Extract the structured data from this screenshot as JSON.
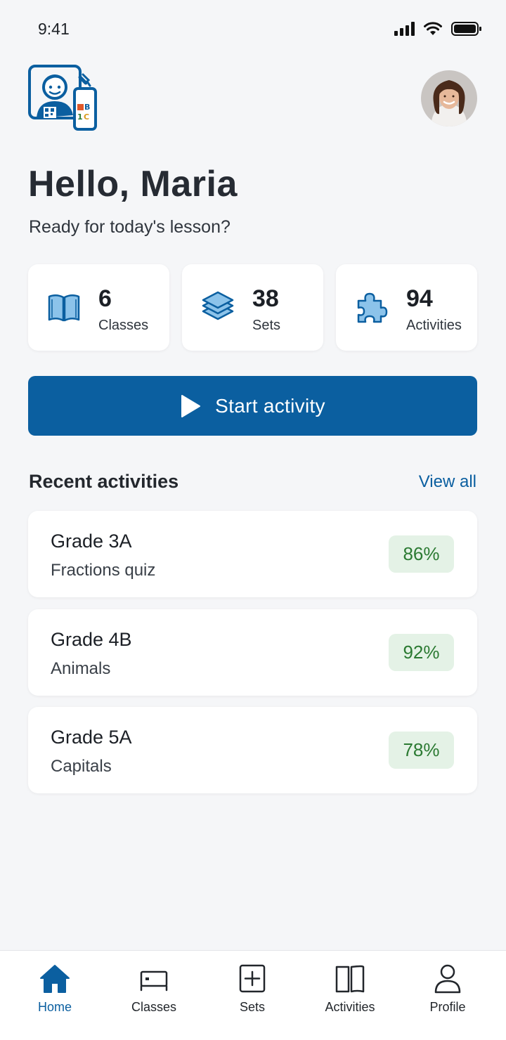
{
  "status_bar": {
    "time": "9:41"
  },
  "header": {
    "greeting": "Hello, Maria",
    "subtitle": "Ready for today's lesson?",
    "logo_icon": "teacher-app-logo",
    "logo_text": "B 1C"
  },
  "stats": [
    {
      "value": "6",
      "label": "Classes",
      "icon": "book-icon"
    },
    {
      "value": "38",
      "label": "Sets",
      "icon": "layers-icon"
    },
    {
      "value": "94",
      "label": "Activities",
      "icon": "puzzle-icon"
    }
  ],
  "start_button": {
    "label": "Start activity"
  },
  "recent": {
    "title": "Recent activities",
    "view_all": "View all",
    "items": [
      {
        "title": "Grade 3A",
        "subtitle": "Fractions quiz",
        "score": "86%"
      },
      {
        "title": "Grade 4B",
        "subtitle": "Animals",
        "score": "92%"
      },
      {
        "title": "Grade 5A",
        "subtitle": "Capitals",
        "score": "78%"
      }
    ]
  },
  "nav": [
    {
      "label": "Home",
      "icon": "home-icon",
      "active": true
    },
    {
      "label": "Classes",
      "icon": "classes-icon"
    },
    {
      "label": "Sets",
      "icon": "plus-square-icon"
    },
    {
      "label": "Activities",
      "icon": "open-book-icon"
    },
    {
      "label": "Profile",
      "icon": "person-icon"
    }
  ],
  "colors": {
    "accent": "#0b5fa0",
    "score_badge_bg": "#e4f2e6",
    "score_badge_text": "#2b7a32",
    "background": "#f5f6f8"
  }
}
